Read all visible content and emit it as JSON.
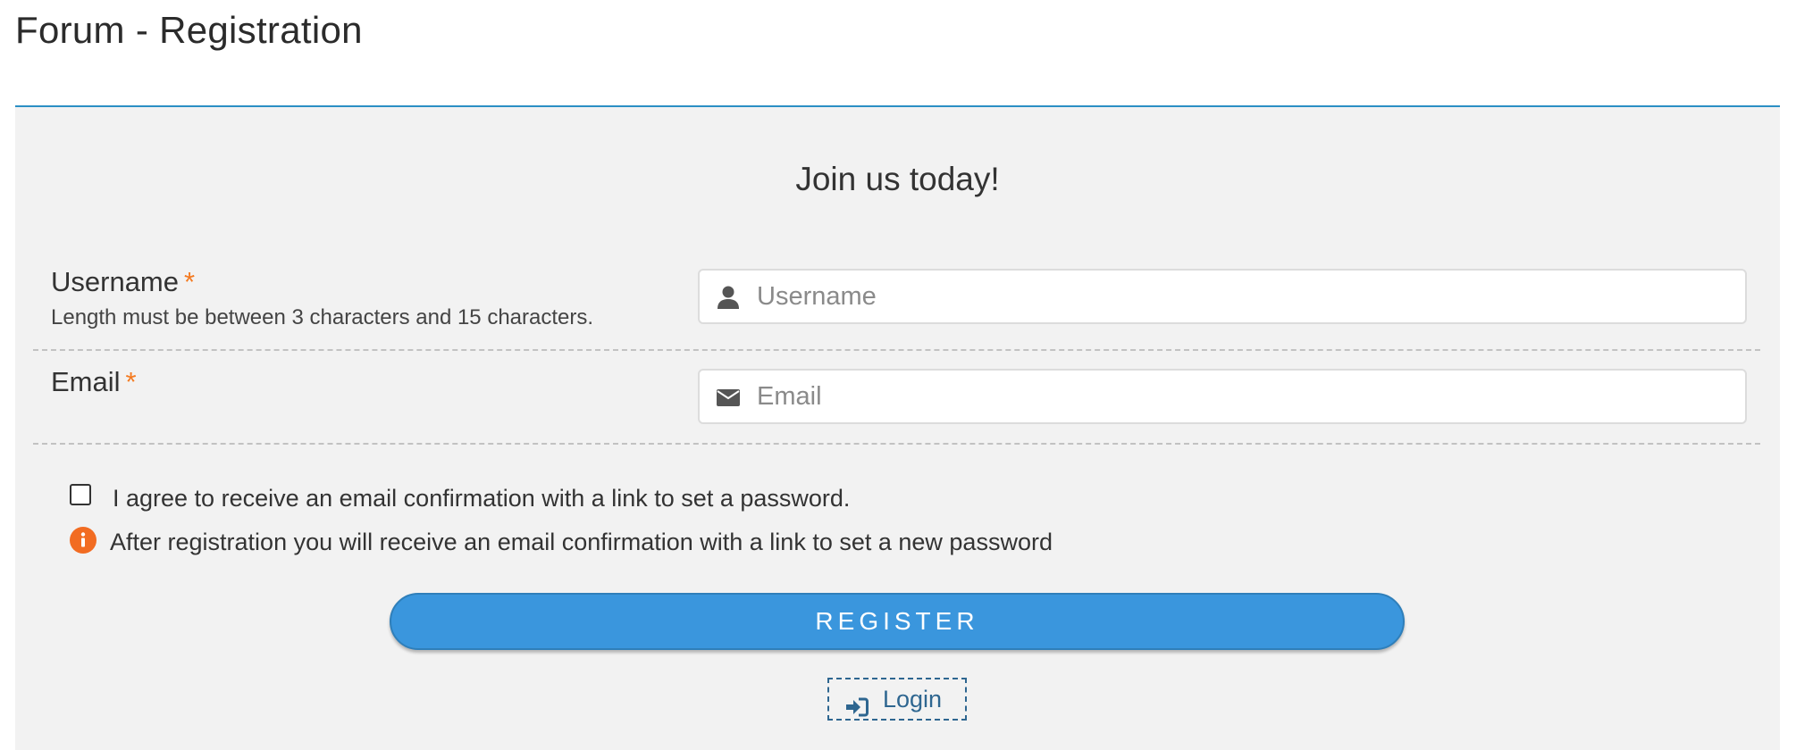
{
  "page": {
    "title": "Forum - Registration"
  },
  "form": {
    "heading": "Join us today!",
    "username": {
      "label": "Username",
      "required_marker": "*",
      "hint": "Length must be between 3 characters and 15 characters.",
      "placeholder": "Username",
      "value": "",
      "icon": "user-icon"
    },
    "email": {
      "label": "Email",
      "required_marker": "*",
      "placeholder": "Email",
      "value": "",
      "icon": "envelope-icon"
    },
    "agree": {
      "label": "I agree to receive an email confirmation with a link to set a password.",
      "checked": false
    },
    "info": {
      "text": "After registration you will receive an email confirmation with a link to set a new password",
      "icon": "info-icon"
    },
    "register_label": "REGISTER",
    "login_label": "Login",
    "login_icon": "sign-in-icon"
  },
  "colors": {
    "accent": "#3a96dd",
    "divider": "#2b8fc4",
    "required": "#f47a20",
    "info": "#f26c22",
    "link": "#2e6690",
    "panel_bg": "#f2f2f2"
  }
}
